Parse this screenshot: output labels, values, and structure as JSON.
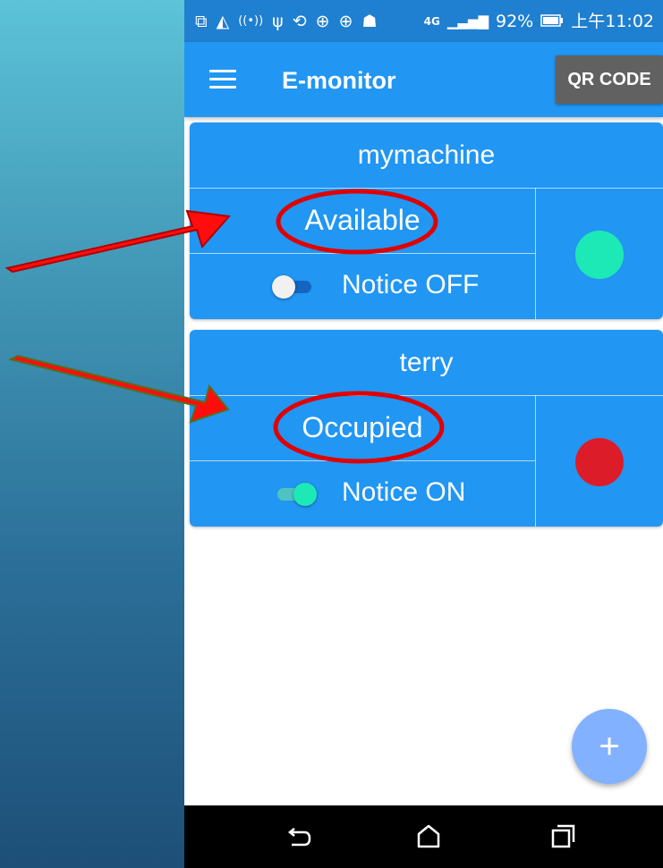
{
  "status_bar": {
    "signal_label": "4G",
    "battery": "92%",
    "time": "上午11:02",
    "icons": [
      "screen-icon",
      "navigation-icon",
      "wifi-calling-icon",
      "usb-icon",
      "sync-icon",
      "download-icon",
      "download-icon",
      "android-icon"
    ]
  },
  "app_bar": {
    "title": "E-monitor",
    "qr_button": "QR CODE",
    "menu_icon": "hamburger-menu-icon"
  },
  "machines": [
    {
      "name": "mymachine",
      "status": "Available",
      "notice_label": "Notice OFF",
      "notice_on": false,
      "status_color": "#1de9b6"
    },
    {
      "name": "terry",
      "status": "Occupied",
      "notice_label": "Notice ON",
      "notice_on": true,
      "status_color": "#dd1c2a"
    }
  ],
  "fab": {
    "label": "+"
  },
  "nav_bar": {
    "icons": [
      "back-icon",
      "home-icon",
      "recents-icon"
    ]
  },
  "colors": {
    "primary": "#2196f3",
    "status_bar": "#1f7fd0",
    "annotation": "#ff0000"
  }
}
